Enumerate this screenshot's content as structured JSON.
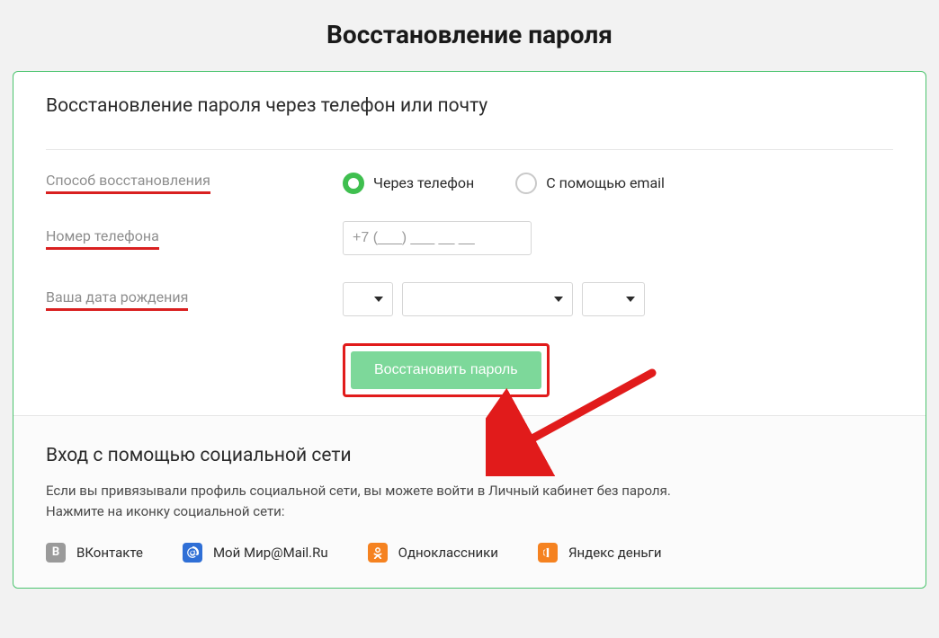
{
  "page": {
    "title": "Восстановление пароля"
  },
  "card": {
    "section_title": "Восстановление пароля через телефон или почту",
    "labels": {
      "method": "Способ восстановления",
      "phone": "Номер телефона",
      "dob": "Ваша дата рождения"
    },
    "radios": {
      "phone": "Через телефон",
      "email": "С помощью email"
    },
    "phone_placeholder": "+7 (___) ___ __ __",
    "submit": "Восстановить пароль"
  },
  "social": {
    "title": "Вход с помощью социальной сети",
    "desc_line1": "Если вы привязывали профиль социальной сети, вы можете войти в Личный кабинет без пароля.",
    "desc_line2": "Нажмите на иконку социальной сети:",
    "links": {
      "vk": "ВКонтакте",
      "mailru": "Мой Мир@Mail.Ru",
      "ok": "Одноклассники",
      "yandex": "Яндекс деньги"
    },
    "icon_letters": {
      "vk": "В"
    }
  }
}
